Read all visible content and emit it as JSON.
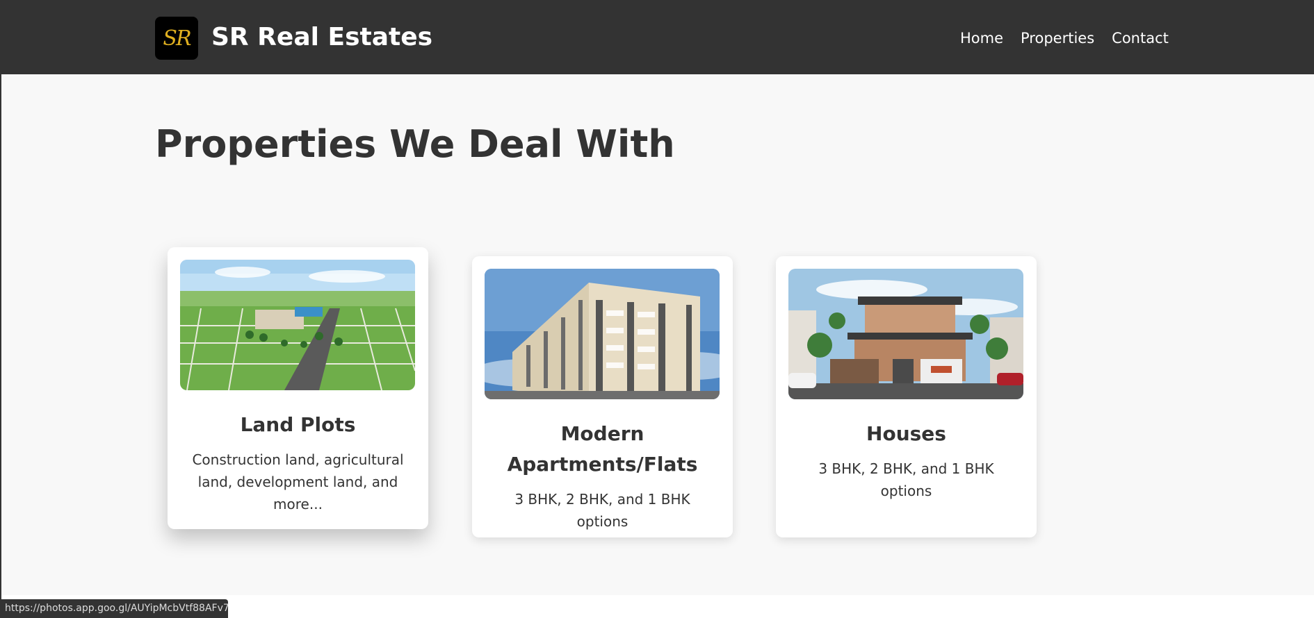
{
  "header": {
    "logo_text": "SR",
    "brand": "SR Real Estates",
    "nav": [
      "Home",
      "Properties",
      "Contact"
    ]
  },
  "main": {
    "title": "Properties We Deal With",
    "cards": [
      {
        "title": "Land Plots",
        "description": "Construction land, agricultural land, development land, and more..."
      },
      {
        "title": "Modern Apartments/Flats",
        "description": "3 BHK, 2 BHK, and 1 BHK options"
      },
      {
        "title": "Houses",
        "description": "3 BHK, 2 BHK, and 1 BHK options"
      }
    ]
  },
  "status_bar": {
    "url": "https://photos.app.goo.gl/AUYipMcbVtf88AFv7"
  },
  "colors": {
    "header_bg": "#333333",
    "page_bg": "#f8f8f8",
    "logo_gold": "#e0b020"
  }
}
